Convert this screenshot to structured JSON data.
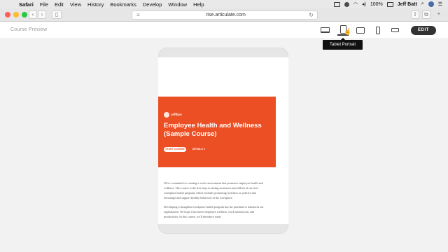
{
  "menubar": {
    "app": "Safari",
    "items": [
      "File",
      "Edit",
      "View",
      "History",
      "Bookmarks",
      "Develop",
      "Window",
      "Help"
    ],
    "battery": "100%",
    "user": "Jeff Batt"
  },
  "browser": {
    "url": "rise.articulate.com"
  },
  "app": {
    "title": "Course Preview",
    "edit_label": "EDIT",
    "tooltip": "Tablet Portrait",
    "devices": [
      "desktop-icon",
      "tablet-portrait-icon",
      "tablet-landscape-icon",
      "phone-portrait-icon",
      "phone-landscape-icon"
    ],
    "active_device": "Tablet Portrait"
  },
  "course": {
    "brand": "jeffbyo",
    "title": "Employee Health and Wellness (Sample Course)",
    "start_label": "START COURSE",
    "details_label": "DETAILS ∨",
    "accent": "#ec4f24",
    "paragraphs": [
      "We're committed to creating a work environment that promotes employee health and wellness. This course is the first step in raising awareness and rollout of our new workplace health program, which includes promoting activities or policies that encourage and support healthy behaviors in the workplace.",
      "Developing a thoughtful workplace health program has the potential to transform our organization. We hope it increases employee wellness, work satisfaction, and productivity. In this course, we'll introduce some"
    ]
  }
}
